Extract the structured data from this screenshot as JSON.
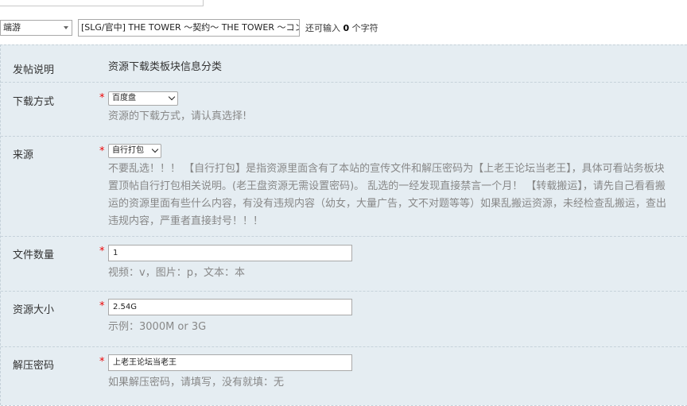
{
  "thread": {
    "type_select_value": "端游",
    "title_value": "[SLG/官中] THE TOWER ～契约～ THE TOWER ～コント",
    "remaining_prefix": "还可输入",
    "remaining_count": "0",
    "remaining_suffix": "个字符"
  },
  "form": {
    "intro": {
      "label": "发帖说明",
      "text": "资源下载类板块信息分类"
    },
    "download_method": {
      "label": "下载方式",
      "required_mark": "*",
      "select_value": "百度盘",
      "hint": "资源的下载方式，请认真选择!"
    },
    "source": {
      "label": "来源",
      "required_mark": "*",
      "select_value": "自行打包",
      "hint_lines": [
        "不要乱选！！！ 【自行打包】是指资源里面含有了本站的宣传文件和解压密码为【上老王论坛当老王】，具体可看站务板块",
        "置顶帖自行打包相关说明。(老王盘资源无需设置密码)。 乱选的一经发现直接禁言一个月！ 【转载搬运】，请先自己看看搬",
        "运的资源里面有些什么内容，有没有违规内容（幼女，大量广告，文不对题等等）如果乱搬运资源，未经检查乱搬运，查出",
        "违规内容，严重者直接封号！！！"
      ]
    },
    "file_count": {
      "label": "文件数量",
      "required_mark": "*",
      "value": "1",
      "hint": "视频：v，图片：p，文本：本"
    },
    "resource_size": {
      "label": "资源大小",
      "required_mark": "*",
      "value": "2.54G",
      "hint": "示例：3000M or 3G"
    },
    "unzip_password": {
      "label": "解压密码",
      "required_mark": "*",
      "value": "上老王论坛当老王",
      "hint": "如果解压密码，请填写，没有就填：无"
    }
  }
}
